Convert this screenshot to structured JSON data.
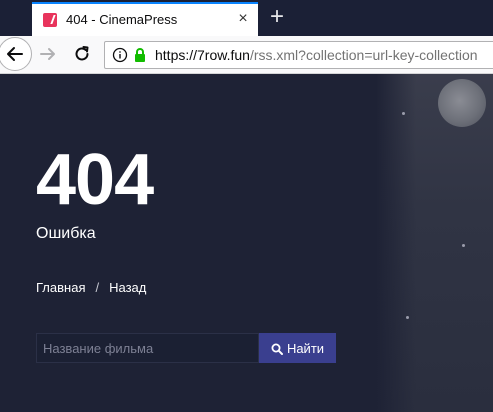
{
  "browser": {
    "tab": {
      "title": "404 - CinemaPress",
      "favicon": "cinemapress-favicon"
    },
    "url": {
      "host": "https://7row.fun",
      "path": "/rss.xml?collection=url-key-collection"
    },
    "icons": {
      "close": "close-icon",
      "new_tab": "plus-icon",
      "back": "back-arrow-icon",
      "forward": "forward-arrow-icon",
      "reload": "reload-icon",
      "info": "info-icon",
      "lock": "lock-icon"
    },
    "new_tab_glyph": "+",
    "close_glyph": "×"
  },
  "page": {
    "code": "404",
    "message": "Ошибка",
    "nav": {
      "home": "Главная",
      "separator": "/",
      "back": "Назад"
    },
    "search": {
      "placeholder": "Название фильма",
      "value": "",
      "button": "Найти",
      "icon": "search-icon"
    }
  },
  "colors": {
    "background": "#1e2235",
    "button": "#3a3f8f",
    "text": "#ffffff",
    "tab_accent": "#0a84ff",
    "lock": "#12bc00"
  }
}
